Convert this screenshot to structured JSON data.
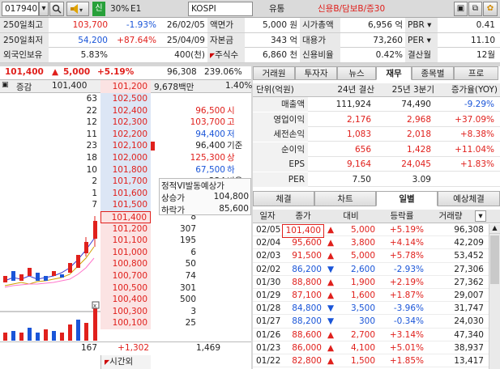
{
  "topbar": {
    "code": "017940",
    "search_icon": "search-icon",
    "sound_icon": "speaker-icon",
    "credit_badge": "신",
    "margin": "30%",
    "group": "E1",
    "market": "KOSPI",
    "sector": "유통",
    "tags": "신용B/담보B/증30"
  },
  "summary": [
    [
      "250일최고",
      "103,700",
      "-1.93%",
      "26/02/05",
      "액면가",
      "5,000 원",
      "시가총액",
      "6,956 억",
      "PBR",
      "0.41"
    ],
    [
      "250일최저",
      "54,200",
      "+87.64%",
      "25/04/09",
      "자본금",
      "343 억",
      "대용가",
      "73,260",
      "PER",
      "11.10"
    ],
    [
      "외국인보유",
      "5.83%",
      "",
      "400(천)",
      "주식수",
      "6,860 천",
      "신용비율",
      "0.42%",
      "결산월",
      "12월"
    ]
  ],
  "price_line": {
    "price": "101,400",
    "arrow": "▲",
    "change": "5,000",
    "rate": "+5.19%",
    "volume": "96,308",
    "vol_ratio": "239.06%"
  },
  "orderbook_header": {
    "label": "증감",
    "cur_vol": "101,400",
    "cur_price": "101,200",
    "amount": "9,678백만",
    "ratio": "1.40%"
  },
  "asks": [
    {
      "qty": "63",
      "price": "102,500"
    },
    {
      "qty": "22",
      "price": "102,400"
    },
    {
      "qty": "12",
      "price": "102,300"
    },
    {
      "qty": "11",
      "price": "102,200"
    },
    {
      "qty": "23",
      "price": "102,100"
    },
    {
      "qty": "18",
      "price": "102,000"
    },
    {
      "qty": "10",
      "price": "101,800"
    },
    {
      "qty": "2",
      "price": "101,700"
    },
    {
      "qty": "1",
      "price": "101,600"
    },
    {
      "qty": "7",
      "price": "101,500"
    }
  ],
  "ask_info": [
    {
      "v": "96,500",
      "k": "시"
    },
    {
      "v": "103,700",
      "k": "고"
    },
    {
      "v": "94,400",
      "k": "저"
    },
    {
      "v": "96,400",
      "k": "기준"
    },
    {
      "v": "125,300",
      "k": "상"
    },
    {
      "v": "67,500",
      "k": "하"
    },
    {
      "v": "234",
      "k": "비용"
    }
  ],
  "vi": {
    "title": "정적VI발동예상가",
    "up_label": "상승가",
    "up": "104,800",
    "down_label": "하락가",
    "down": "85,600"
  },
  "bids": [
    {
      "price": "101,400",
      "qty": "8"
    },
    {
      "price": "101,200",
      "qty": "307"
    },
    {
      "price": "101,100",
      "qty": "195"
    },
    {
      "price": "101,000",
      "qty": "6"
    },
    {
      "price": "100,800",
      "qty": "50"
    },
    {
      "price": "100,700",
      "qty": "74"
    },
    {
      "price": "100,500",
      "qty": "301"
    },
    {
      "price": "100,400",
      "qty": "500"
    },
    {
      "price": "100,300",
      "qty": "3"
    },
    {
      "price": "100,100",
      "qty": "25"
    }
  ],
  "ob_footer": {
    "total_ask": "167",
    "diff": "+1,302",
    "total_bid": "1,469",
    "after_hours": "시간외"
  },
  "tabs1": [
    "거래원",
    "투자자",
    "뉴스",
    "재무",
    "종목별",
    "프로"
  ],
  "fin_header": [
    "단위(억원)",
    "24년 결산",
    "25년 3분기",
    "증가율(YOY)"
  ],
  "fin_rows": [
    [
      "매출액",
      "111,924",
      "74,490",
      "-9.29%"
    ],
    [
      "영업이익",
      "2,176",
      "2,968",
      "+37.09%"
    ],
    [
      "세전손익",
      "1,083",
      "2,018",
      "+8.38%"
    ],
    [
      "순이익",
      "656",
      "1,428",
      "+11.04%"
    ],
    [
      "EPS",
      "9,164",
      "24,045",
      "+1.83%"
    ],
    [
      "PER",
      "7.50",
      "3.09",
      ""
    ]
  ],
  "tabs2": [
    "체결",
    "차트",
    "일별",
    "예상체결"
  ],
  "daily_header": [
    "일자",
    "종가",
    "대비",
    "등락률",
    "거래량"
  ],
  "daily": [
    [
      "02/05",
      "101,400",
      "▲",
      "5,000",
      "+5.19%",
      "96,308"
    ],
    [
      "02/04",
      "95,600",
      "▲",
      "3,800",
      "+4.14%",
      "42,209"
    ],
    [
      "02/03",
      "91,500",
      "▲",
      "5,000",
      "+5.78%",
      "53,452"
    ],
    [
      "02/02",
      "86,200",
      "▼",
      "2,600",
      "-2.93%",
      "27,306"
    ],
    [
      "01/30",
      "88,800",
      "▲",
      "1,900",
      "+2.19%",
      "27,362"
    ],
    [
      "01/29",
      "87,100",
      "▲",
      "1,600",
      "+1.87%",
      "29,007"
    ],
    [
      "01/28",
      "84,800",
      "▼",
      "3,500",
      "-3.96%",
      "31,747"
    ],
    [
      "01/27",
      "88,200",
      "▼",
      "300",
      "-0.34%",
      "24,030"
    ],
    [
      "01/26",
      "88,600",
      "▲",
      "2,700",
      "+3.14%",
      "47,340"
    ],
    [
      "01/23",
      "86,000",
      "▲",
      "4,100",
      "+5.01%",
      "38,937"
    ],
    [
      "01/22",
      "82,800",
      "▲",
      "1,500",
      "+1.85%",
      "13,417"
    ]
  ]
}
